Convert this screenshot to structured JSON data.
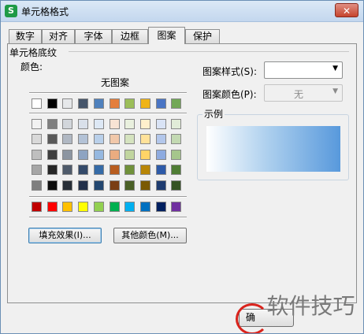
{
  "window": {
    "title": "单元格格式",
    "app_icon_letter": "S",
    "close_symbol": "✕"
  },
  "tabs": [
    {
      "label": "数字",
      "active": false
    },
    {
      "label": "对齐",
      "active": false
    },
    {
      "label": "字体",
      "active": false
    },
    {
      "label": "边框",
      "active": false
    },
    {
      "label": "图案",
      "active": true
    },
    {
      "label": "保护",
      "active": false
    }
  ],
  "shading": {
    "group_title": "单元格底纹",
    "color_label": "颜色:",
    "no_pattern_label": "无图案",
    "palette_top": [
      "#ffffff",
      "#000000",
      "#e6e8ea",
      "#46566b",
      "#4f81bd",
      "#e47e3c",
      "#9cbe59",
      "#f0b418",
      "#4a75c4",
      "#72a856"
    ],
    "palette_tints": [
      [
        "#f2f2f2",
        "#7f7f7f",
        "#d2d6db",
        "#d9e0ea",
        "#dde8f5",
        "#f8e3d4",
        "#e9f0de",
        "#fff0cc",
        "#d9e3f5",
        "#e1ecd8"
      ],
      [
        "#d9d9d9",
        "#595959",
        "#b0b8c3",
        "#b3c2d6",
        "#b9d0ea",
        "#f1c8aa",
        "#d5e3bf",
        "#ffe29a",
        "#b3c7eb",
        "#c3d9b2"
      ],
      [
        "#bfbfbf",
        "#3f3f3f",
        "#8c95a1",
        "#8ea4c2",
        "#95b8e0",
        "#eaac80",
        "#c1d59f",
        "#ffd467",
        "#8eabe0",
        "#a5c68c"
      ],
      [
        "#a6a6a6",
        "#262626",
        "#4e5a6a",
        "#344a6a",
        "#356ba7",
        "#b85d1f",
        "#70913a",
        "#b88607",
        "#2d5aa8",
        "#4f7d34"
      ],
      [
        "#7f7f7f",
        "#0d0d0d",
        "#262d36",
        "#22304a",
        "#234770",
        "#7a3e15",
        "#4b6127",
        "#7a5904",
        "#1e3c70",
        "#355323"
      ]
    ],
    "palette_standard": [
      "#c00000",
      "#ff0000",
      "#ffc000",
      "#ffff00",
      "#92d050",
      "#00b050",
      "#00b0f0",
      "#0070c0",
      "#002060",
      "#7030a0"
    ],
    "fill_effects_button": "填充效果(I)...",
    "more_colors_button": "其他颜色(M)..."
  },
  "pattern": {
    "style_label": "图案样式(S):",
    "style_value": "",
    "color_label": "图案颜色(P):",
    "color_value": "无"
  },
  "example": {
    "title": "示例",
    "fill_start": "#ffffff",
    "fill_end": "#5899dc"
  },
  "footer": {
    "ok_button": "确",
    "annotation_color": "#d9231c"
  },
  "watermark": "软件技巧"
}
